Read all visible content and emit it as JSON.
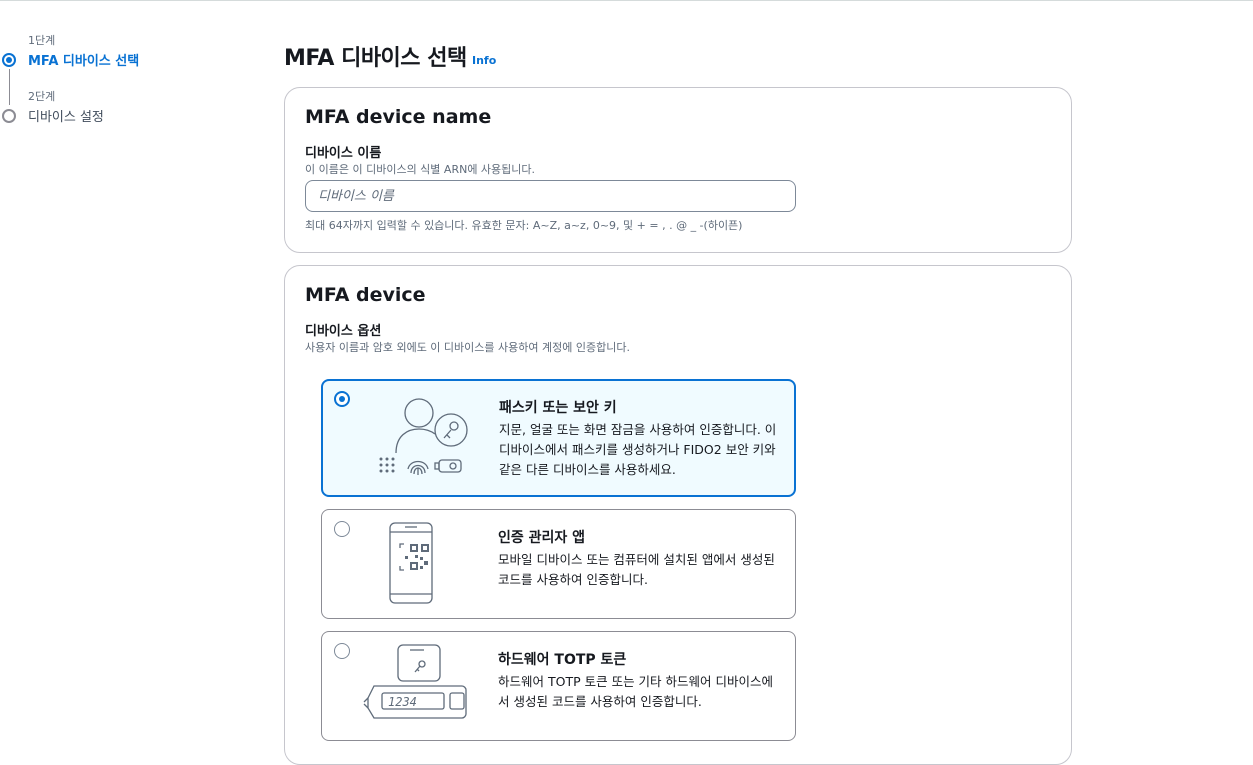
{
  "stepper": {
    "steps": [
      {
        "number": "1단계",
        "label": "MFA 디바이스 선택"
      },
      {
        "number": "2단계",
        "label": "디바이스 설정"
      }
    ]
  },
  "page": {
    "title": "MFA 디바이스 선택",
    "info_link": "Info"
  },
  "device_name_panel": {
    "title": "MFA device name",
    "field_label": "디바이스 이름",
    "field_description": "이 이름은 이 디바이스의 식별 ARN에 사용됩니다.",
    "input_value": "",
    "input_placeholder": "디바이스 이름",
    "constraint_text": "최대 64자까지 입력할 수 있습니다. 유효한 문자: A~Z, a~z, 0~9, 및 + = , . @ _ -(하이픈)"
  },
  "device_panel": {
    "title": "MFA device",
    "field_label": "디바이스 옵션",
    "field_description": "사용자 이름과 암호 외에도 이 디바이스를 사용하여 계정에 인증합니다.",
    "options": [
      {
        "title": "패스키 또는 보안 키",
        "description": "지문, 얼굴 또는 화면 잠금을 사용하여 인증합니다. 이 디바이스에서 패스키를 생성하거나 FIDO2 보안 키와 같은 다른 디바이스를 사용하세요.",
        "selected": true,
        "icon": "passkey-illustration-icon"
      },
      {
        "title": "인증 관리자 앱",
        "description": "모바일 디바이스 또는 컴퓨터에 설치된 앱에서 생성된 코드를 사용하여 인증합니다.",
        "selected": false,
        "icon": "authenticator-app-illustration-icon"
      },
      {
        "title": "하드웨어 TOTP 토큰",
        "description": "하드웨어 TOTP 토큰 또는 기타 하드웨어 디바이스에서 생성된 코드를 사용하여 인증합니다.",
        "selected": false,
        "icon": "hardware-token-illustration-icon",
        "token_display": "1234"
      }
    ]
  },
  "colors": {
    "accent": "#0972d3",
    "selected_background": "#f0fbff",
    "border": "#c6c6cd",
    "text": "#16191f",
    "secondary_text": "#5f6b7a"
  }
}
